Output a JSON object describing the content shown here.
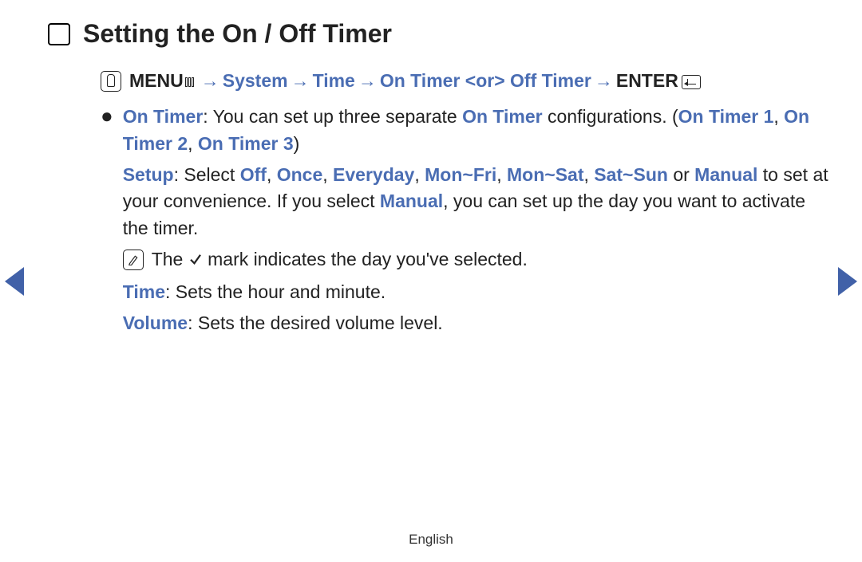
{
  "title": "Setting the On / Off Timer",
  "navpath": {
    "menu": "MENU",
    "arrow": " → ",
    "system": "System",
    "time": "Time",
    "onofftimer": "On Timer <or> Off Timer",
    "enter": "ENTER"
  },
  "bullet": {
    "on_timer_label": "On Timer",
    "text_a": ": You can set up three separate ",
    "on_timer_label_2": "On Timer",
    "text_b": " configurations. (",
    "cfg1": "On Timer 1",
    "comma": ", ",
    "cfg2": "On Timer 2",
    "cfg3": "On Timer 3",
    "close_paren": ")",
    "setup_label": "Setup",
    "setup_a": ": Select ",
    "opt_off": "Off",
    "opt_once": "Once",
    "opt_everyday": "Everyday",
    "opt_monfri": "Mon~Fri",
    "opt_monsat": "Mon~Sat",
    "opt_satsun": "Sat~Sun",
    "or": " or ",
    "opt_manual": "Manual",
    "setup_b": " to set at your convenience. If you select ",
    "opt_manual_2": "Manual",
    "setup_c": ", you can set up the day you want to activate the timer.",
    "note_a": "The ",
    "note_b": " mark indicates the day you've selected.",
    "time_label": "Time",
    "time_text": ": Sets the hour and minute.",
    "volume_label": "Volume",
    "volume_text": ": Sets the desired volume level."
  },
  "footer": "English"
}
